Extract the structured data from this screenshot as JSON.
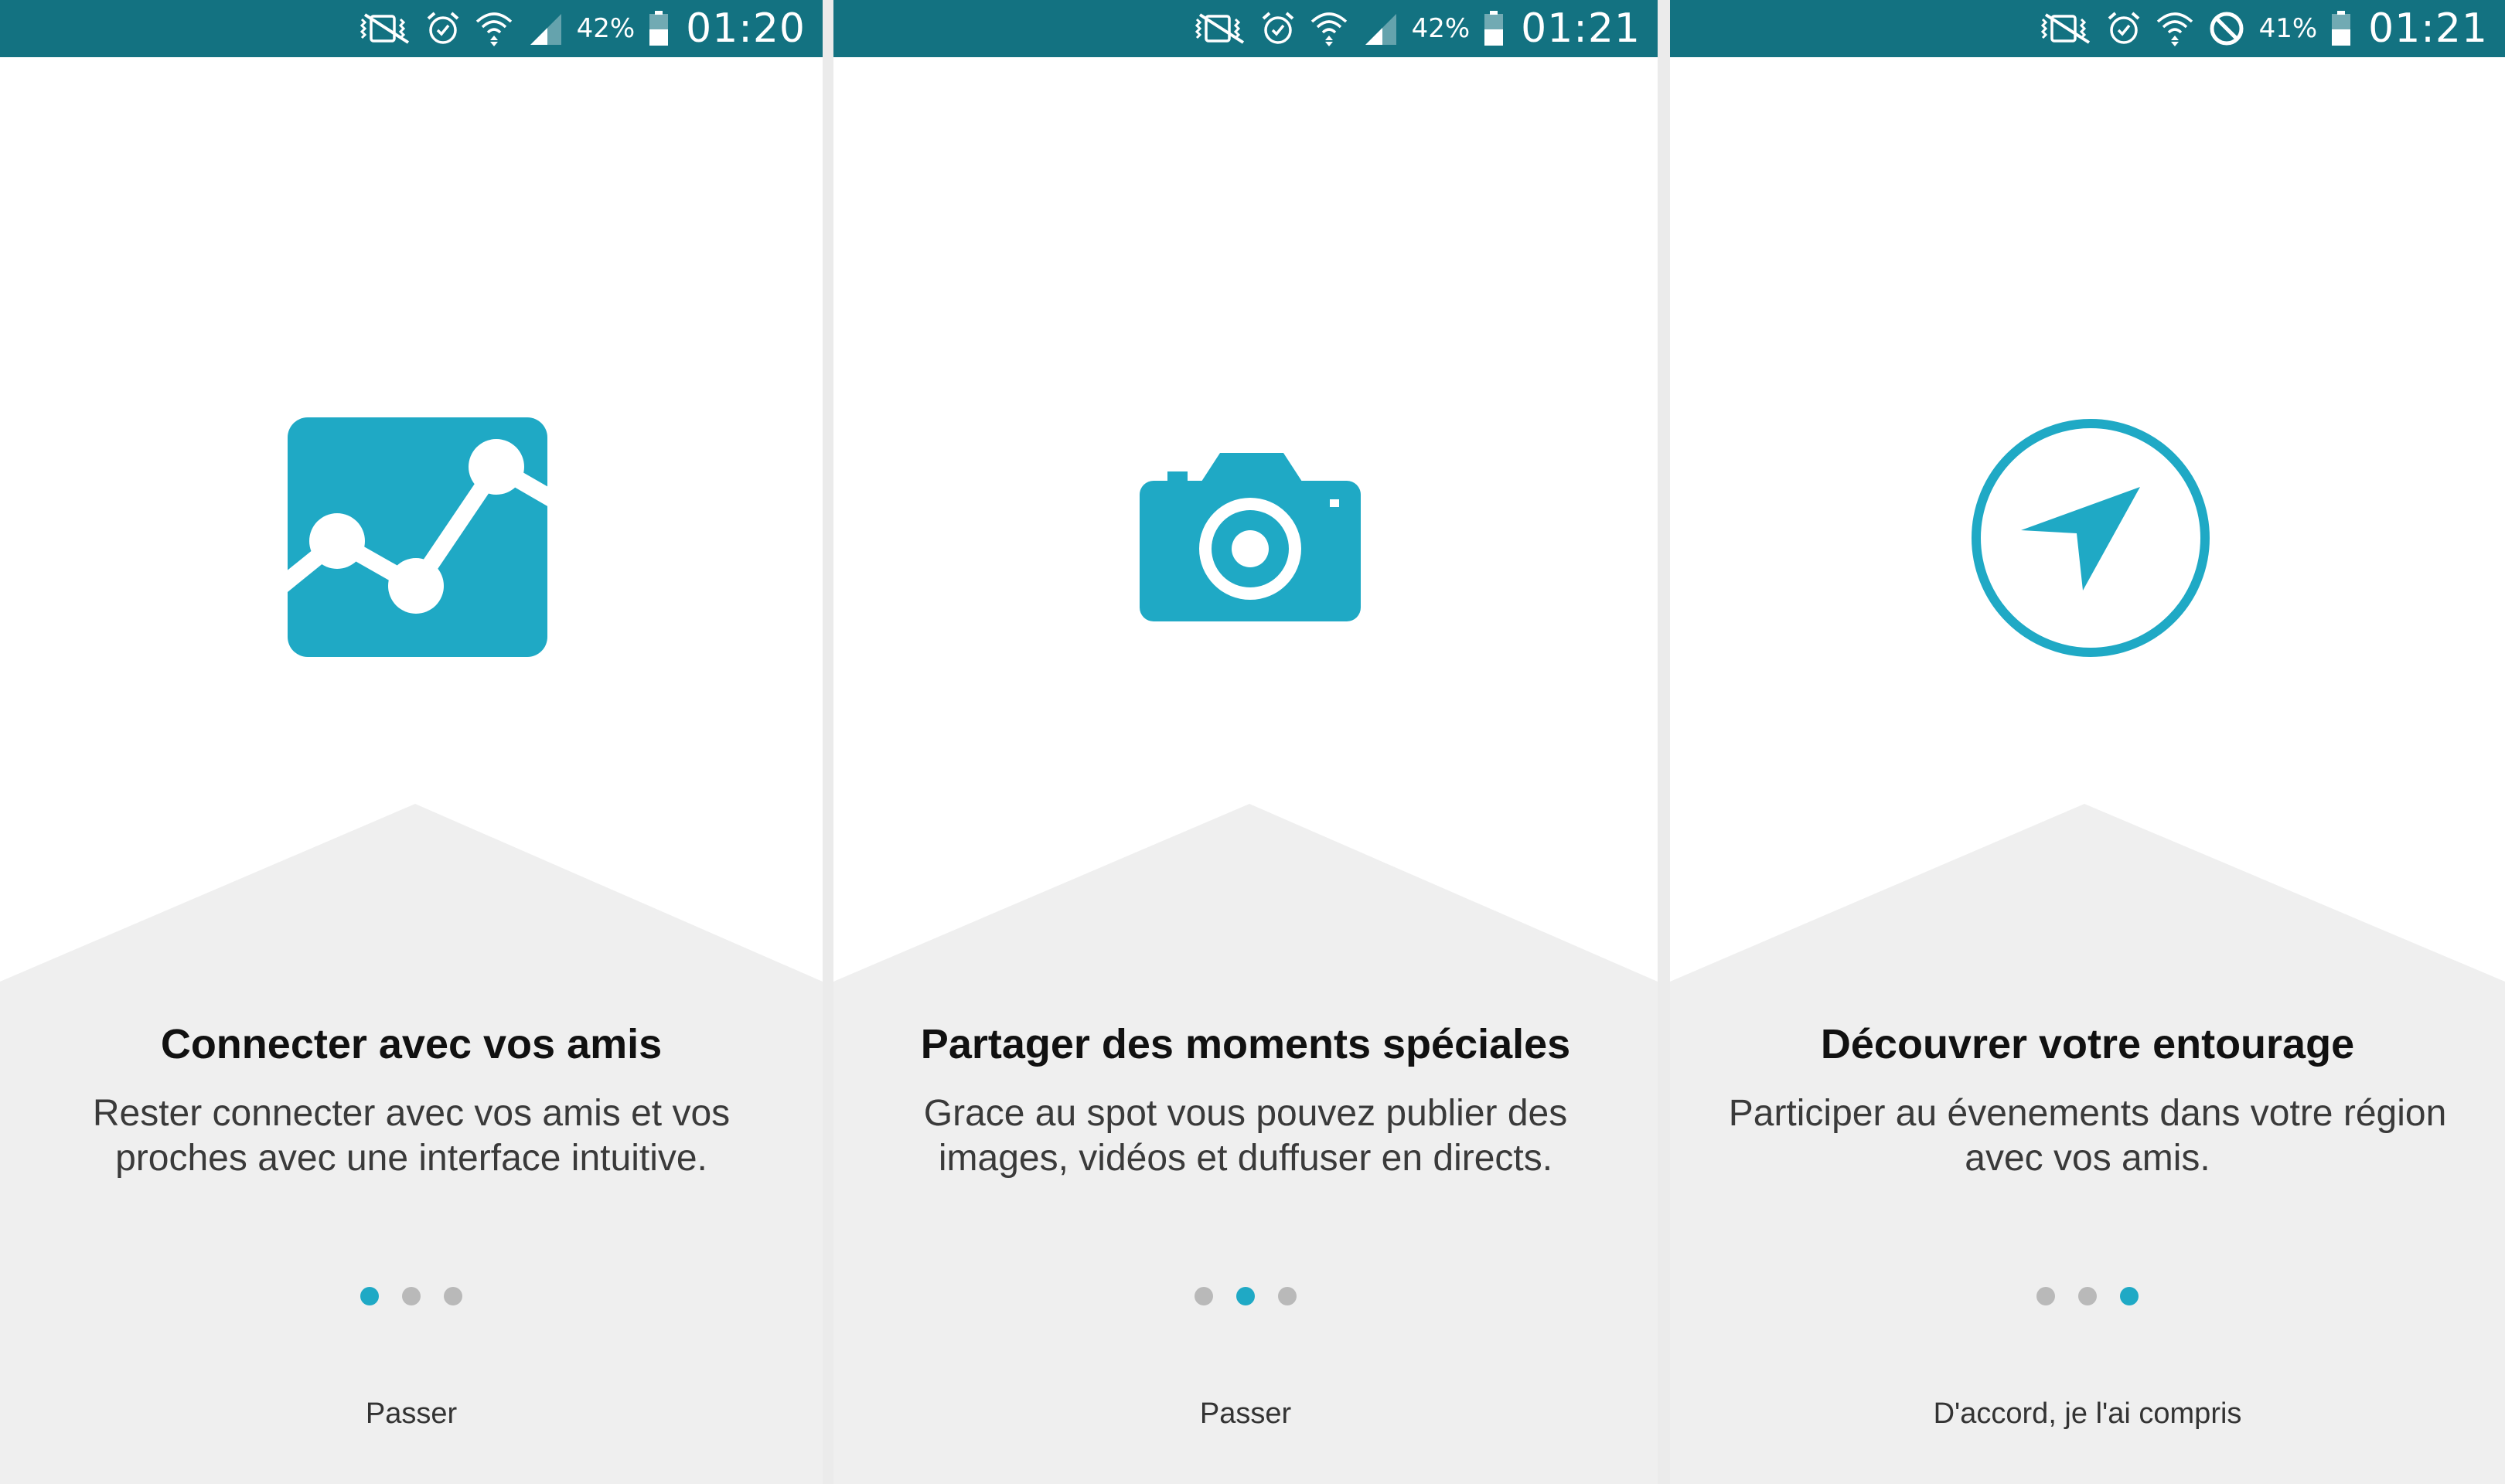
{
  "colors": {
    "status_bar": "#137281",
    "accent": "#1fa9c5",
    "dot_inactive": "#b9b9b9",
    "bottom_bg": "#efefef",
    "divider": "#ebebeb"
  },
  "panels": [
    {
      "status": {
        "battery": "42%",
        "time": "01:20",
        "icons": [
          "vibrate-icon",
          "alarm-icon",
          "wifi-icon",
          "signal-icon",
          "battery-icon"
        ]
      },
      "hero_icon": "chart-icon",
      "title": "Connecter avec vos amis",
      "description": "Rester connecter avec vos amis et vos proches avec une interface intuitive.",
      "dots": {
        "count": 3,
        "active": 1
      },
      "action": "Passer"
    },
    {
      "status": {
        "battery": "42%",
        "time": "01:21",
        "icons": [
          "vibrate-icon",
          "alarm-icon",
          "wifi-icon",
          "signal-icon",
          "battery-icon"
        ]
      },
      "hero_icon": "camera-icon",
      "title": "Partager des moments spéciales",
      "description": "Grace au spot vous pouvez publier des images, vidéos et duffuser en directs.",
      "dots": {
        "count": 3,
        "active": 2
      },
      "action": "Passer"
    },
    {
      "status": {
        "battery": "41%",
        "time": "01:21",
        "icons": [
          "vibrate-icon",
          "alarm-icon",
          "wifi-icon",
          "no-signal-icon",
          "battery-icon"
        ]
      },
      "hero_icon": "navigation-icon",
      "title": "Découvrer votre entourage",
      "description": "Participer au évenements dans votre région avec vos amis.",
      "dots": {
        "count": 3,
        "active": 3
      },
      "action": "D'accord, je l'ai compris"
    }
  ]
}
